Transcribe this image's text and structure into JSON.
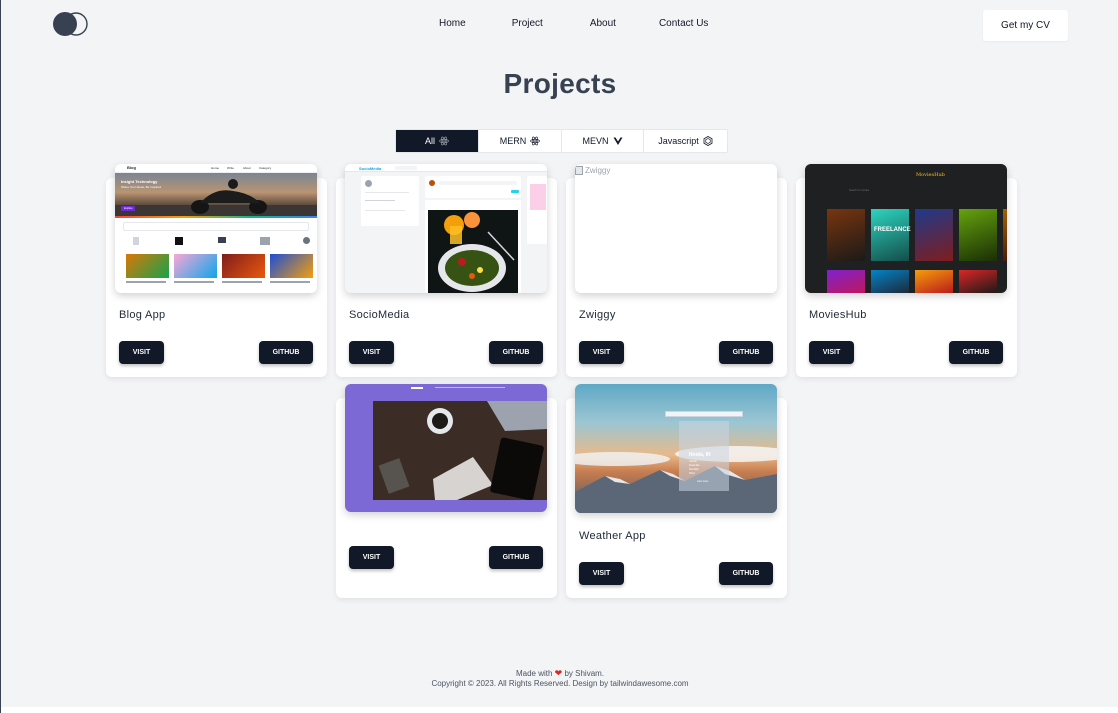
{
  "nav": {
    "links": [
      "Home",
      "Project",
      "About",
      "Contact Us"
    ],
    "cv_button": "Get my CV"
  },
  "page_title": "Projects",
  "tabs": [
    {
      "label": "All",
      "icon": "react-icon",
      "active": true
    },
    {
      "label": "MERN",
      "icon": "react-icon",
      "active": false
    },
    {
      "label": "MEVN",
      "icon": "vue-icon",
      "active": false
    },
    {
      "label": "Javascript",
      "icon": "nodejs-icon",
      "active": false
    }
  ],
  "projects": [
    {
      "title": "Blog App",
      "visit": "VISIT",
      "github": "GITHUB"
    },
    {
      "title": "SocioMedia",
      "visit": "VISIT",
      "github": "GITHUB"
    },
    {
      "title": "Zwiggy",
      "visit": "VISIT",
      "github": "GITHUB",
      "broken_image_alt": "Zwiggy"
    },
    {
      "title": "MoviesHub",
      "visit": "VISIT",
      "github": "GITHUB"
    },
    {
      "title": "",
      "visit": "VISIT",
      "github": "GITHUB"
    },
    {
      "title": "Weather App",
      "visit": "VISIT",
      "github": "GITHUB"
    }
  ],
  "thumbs": {
    "blog": {
      "brand": "Blog",
      "nav": [
        "Home",
        "Write",
        "About",
        "Category"
      ],
      "hero": "Insight Technology",
      "sub": "Share Your Ideas, Be Inspired",
      "btn": "Explore"
    },
    "socio": {
      "brand": "SocioMedia"
    },
    "movies": {
      "brand": "MoviesHub",
      "search": "Search for movies",
      "titles": [
        "",
        "FREELANCE",
        "",
        "",
        ""
      ]
    },
    "weather": {
      "city": "Noida, IN",
      "lines": [
        "Clouds",
        "Feels like",
        "Humidity",
        "Wind"
      ],
      "btn": "view more"
    }
  },
  "footer": {
    "made_prefix": "Made with",
    "made_suffix": "by Shivam.",
    "copyright": "Copyright © 2023. All Rights Reserved. Design by tailwindawesome.com"
  },
  "colors": {
    "primary": "#111827",
    "background": "#f3f4f6",
    "heart": "#dc2626"
  }
}
